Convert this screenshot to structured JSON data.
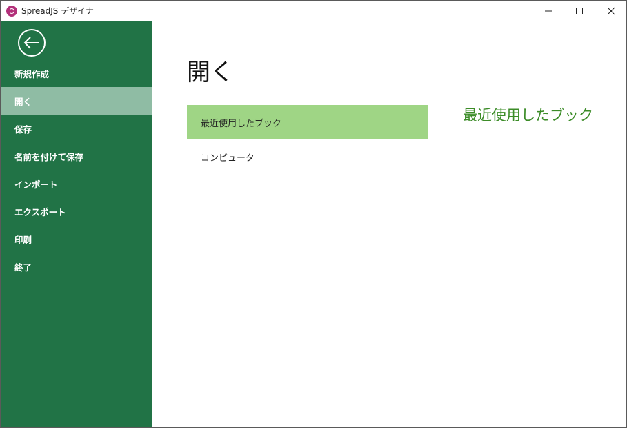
{
  "window": {
    "title": "SpreadJS デザイナ",
    "controls": [
      "minimize",
      "maximize",
      "close"
    ]
  },
  "sidebar": {
    "back_icon": "back-arrow-icon",
    "items": [
      {
        "label": "新規作成",
        "active": false
      },
      {
        "label": "開く",
        "active": true
      },
      {
        "label": "保存",
        "active": false
      },
      {
        "label": "名前を付けて保存",
        "active": false
      },
      {
        "label": "インポート",
        "active": false
      },
      {
        "label": "エクスポート",
        "active": false
      },
      {
        "label": "印刷",
        "active": false
      },
      {
        "label": "終了",
        "active": false
      }
    ]
  },
  "main": {
    "title": "開く",
    "options": [
      {
        "label": "最近使用したブック",
        "active": true
      },
      {
        "label": "コンピュータ",
        "active": false
      }
    ],
    "section_heading": "最近使用したブック"
  },
  "colors": {
    "sidebar_bg": "#217346",
    "sidebar_active": "#8fbca4",
    "option_active": "#9fd585",
    "heading_green": "#3c8c28",
    "logo": "#b2307a"
  }
}
